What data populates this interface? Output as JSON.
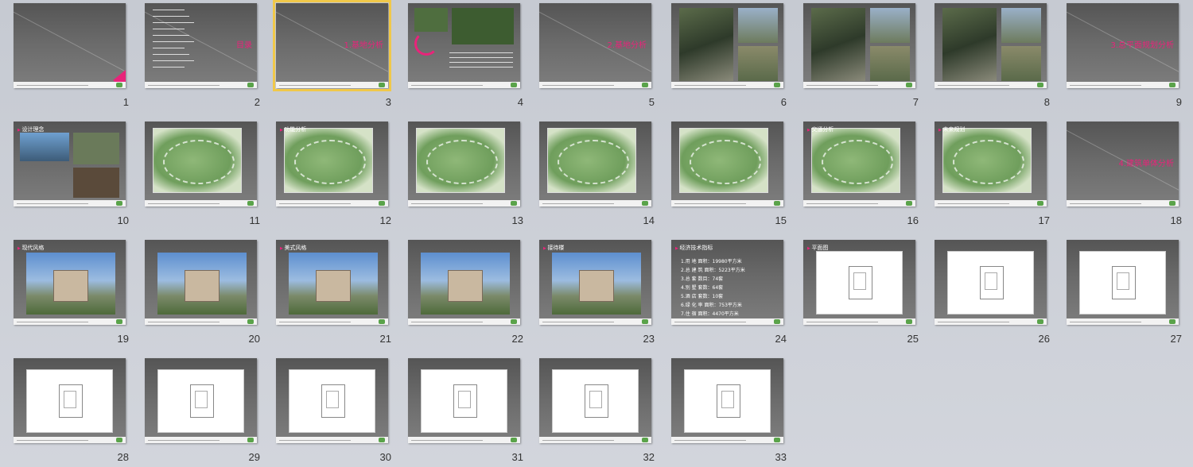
{
  "app": {
    "view": "slide-sorter"
  },
  "colors": {
    "accent": "#e8247a",
    "selection": "#f0c84a",
    "background": "#c9ccd3"
  },
  "slides": [
    {
      "n": "1",
      "title": ""
    },
    {
      "n": "2",
      "title": "目录"
    },
    {
      "n": "3",
      "title": "1.基地分析",
      "selected": true
    },
    {
      "n": "4",
      "title": ""
    },
    {
      "n": "5",
      "title": "2.基地分析"
    },
    {
      "n": "6",
      "title": ""
    },
    {
      "n": "7",
      "title": ""
    },
    {
      "n": "8",
      "title": ""
    },
    {
      "n": "9",
      "title": "3.总平面规划分析"
    },
    {
      "n": "10",
      "title": "设计理念"
    },
    {
      "n": "11",
      "title": ""
    },
    {
      "n": "12",
      "title": "功能分析"
    },
    {
      "n": "13",
      "title": ""
    },
    {
      "n": "14",
      "title": ""
    },
    {
      "n": "15",
      "title": ""
    },
    {
      "n": "16",
      "title": "交通分析"
    },
    {
      "n": "17",
      "title": "未来规划"
    },
    {
      "n": "18",
      "title": "4.建筑单体分析"
    },
    {
      "n": "19",
      "title": "现代风格"
    },
    {
      "n": "20",
      "title": ""
    },
    {
      "n": "21",
      "title": "美式风格"
    },
    {
      "n": "22",
      "title": ""
    },
    {
      "n": "23",
      "title": "接待楼"
    },
    {
      "n": "24",
      "title": "经济技术指标"
    },
    {
      "n": "25",
      "title": "平面图"
    },
    {
      "n": "26",
      "title": ""
    },
    {
      "n": "27",
      "title": ""
    },
    {
      "n": "28",
      "title": ""
    },
    {
      "n": "29",
      "title": ""
    },
    {
      "n": "30",
      "title": ""
    },
    {
      "n": "31",
      "title": ""
    },
    {
      "n": "32",
      "title": ""
    },
    {
      "n": "33",
      "title": ""
    }
  ],
  "slide24_items": [
    "1.用 地 面积：19980平方米",
    "2.总 建 筑 面积：5223平方米",
    "3.总 套 数目：74套",
    "4.别 墅 套数：64套",
    "5.酒 店 套数：10套",
    "6.绿 化 率 面积：753平方米",
    "7.住 宿 面积：4470平方米"
  ]
}
